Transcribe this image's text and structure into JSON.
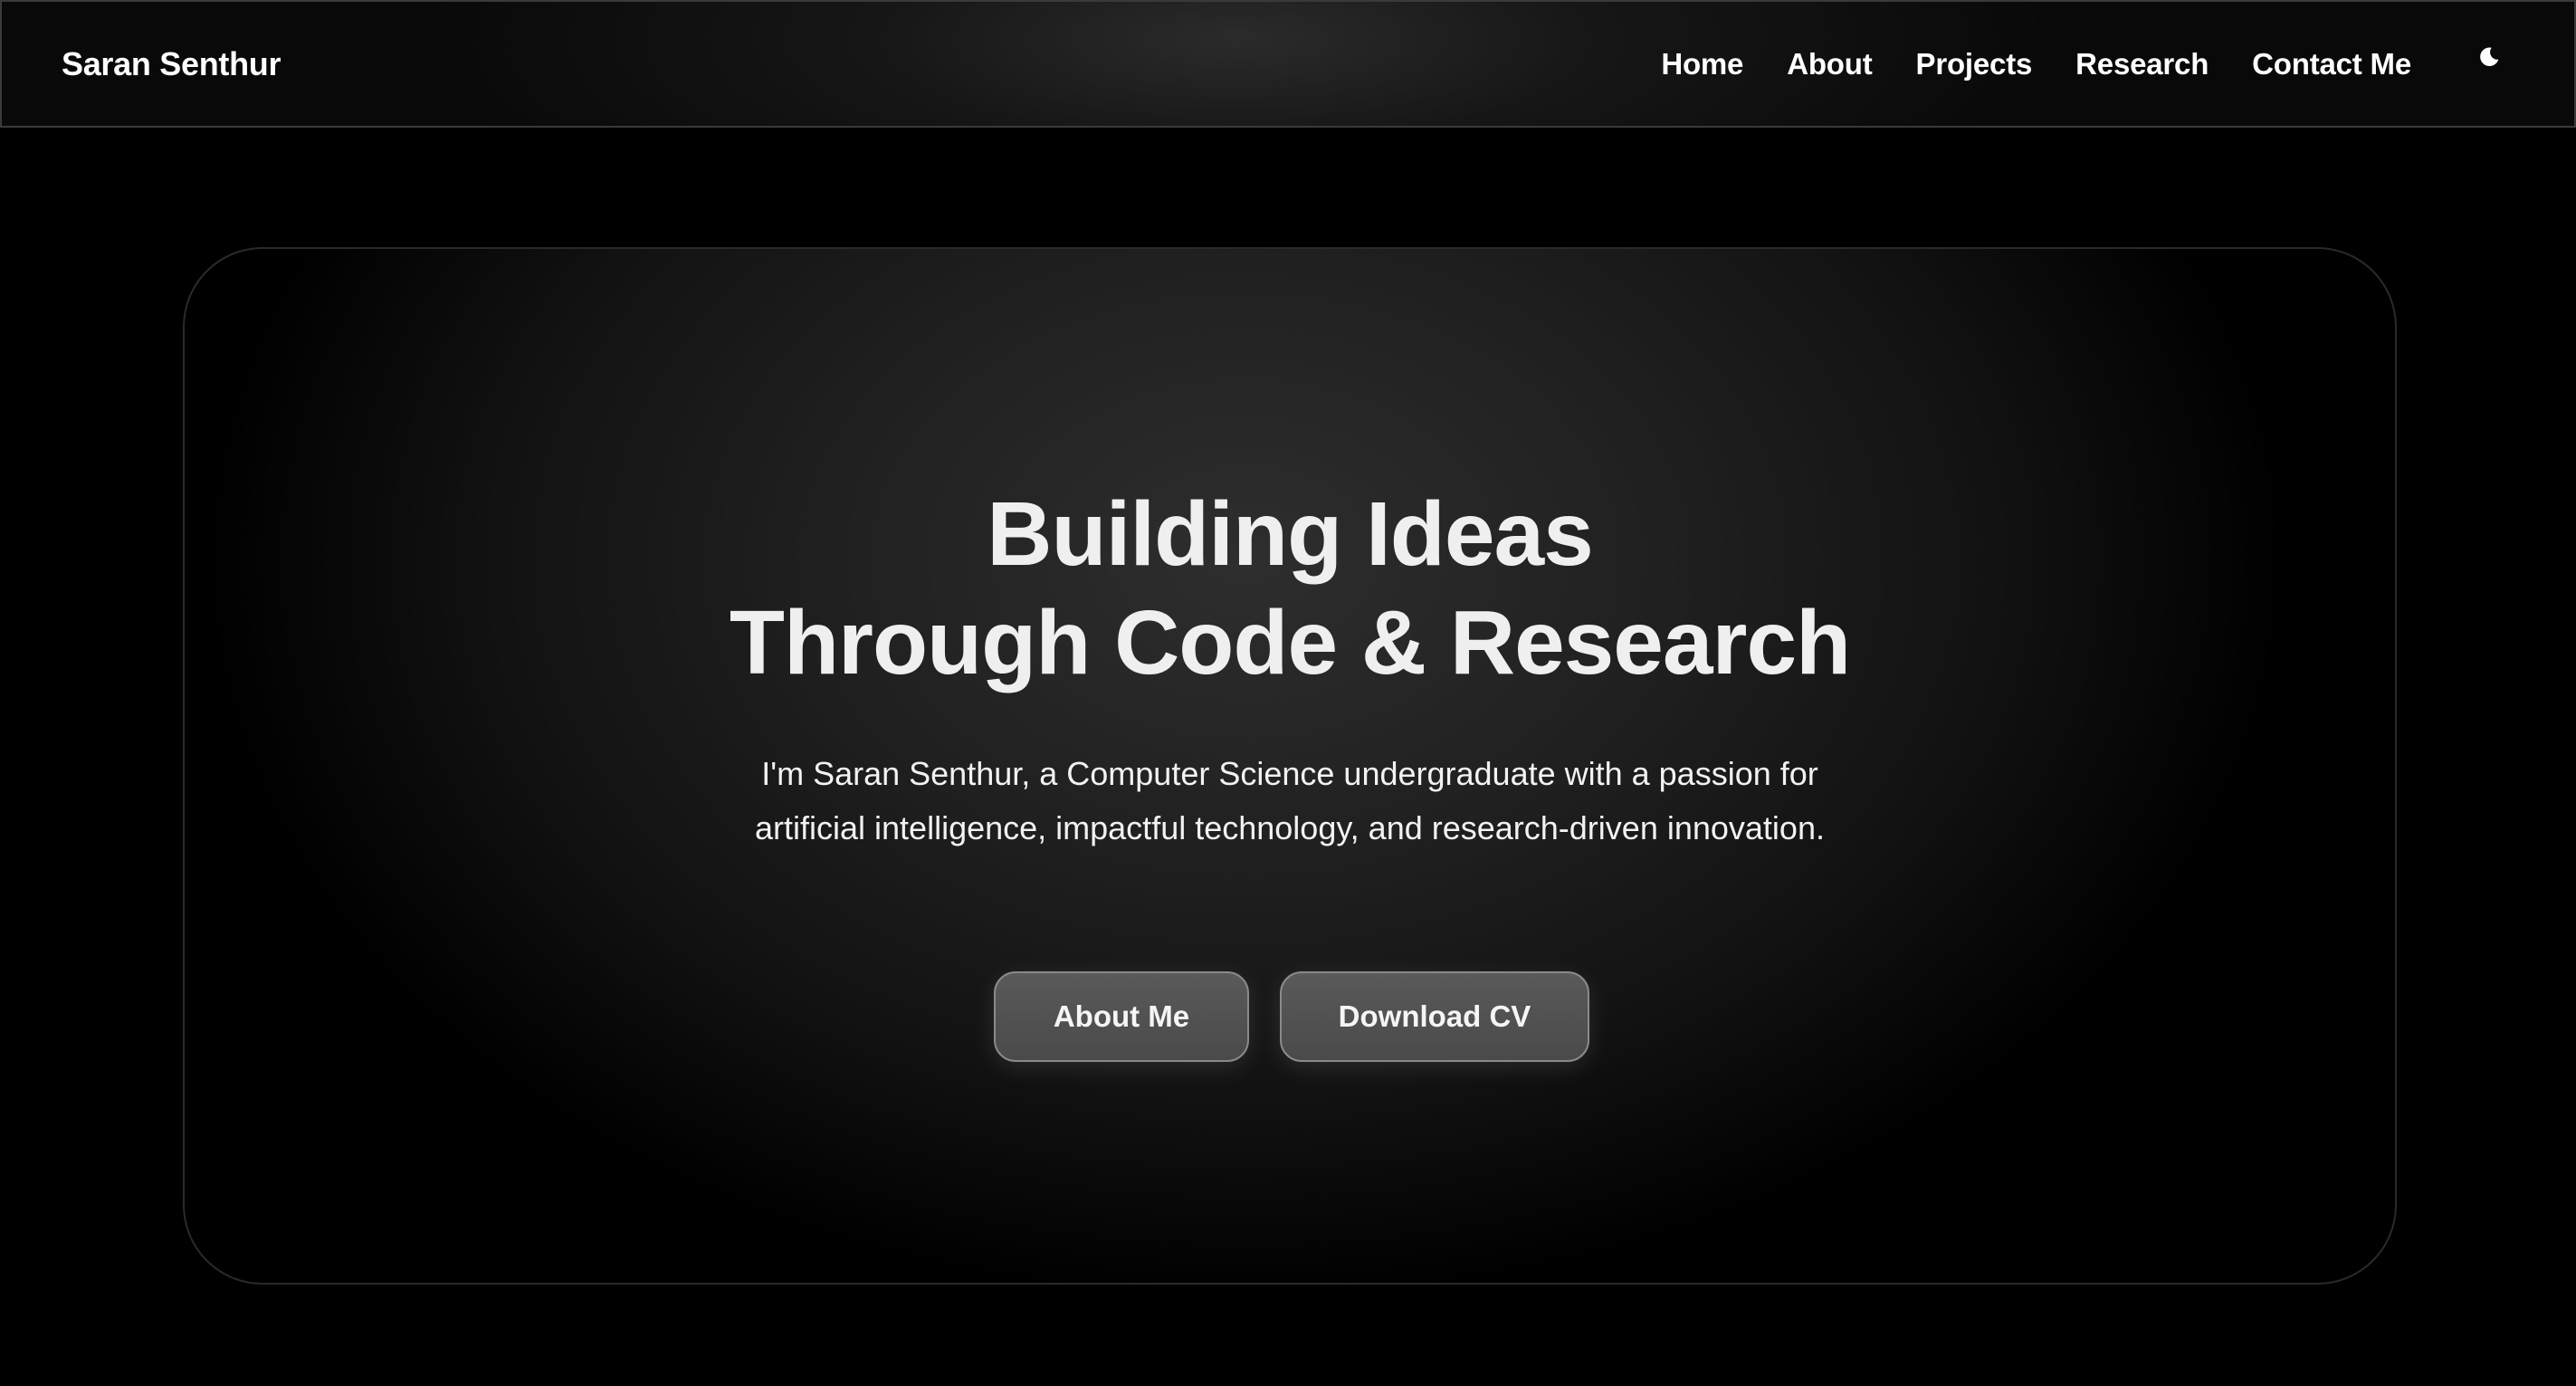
{
  "navbar": {
    "brand": "Saran Senthur",
    "links": [
      "Home",
      "About",
      "Projects",
      "Research",
      "Contact Me"
    ],
    "theme_icon": "moon-icon"
  },
  "hero": {
    "headline_line1": "Building Ideas",
    "headline_line2": "Through Code & Research",
    "intro": "I'm Saran Senthur, a Computer Science undergraduate with a passion for artificial intelligence, impactful technology, and research-driven innovation.",
    "buttons": {
      "about_label": "About Me",
      "cv_label": "Download CV"
    }
  },
  "colors": {
    "background": "#000000",
    "text": "#f0f0f0",
    "button_fill": "#555555",
    "button_border": "#8a8a8a"
  }
}
